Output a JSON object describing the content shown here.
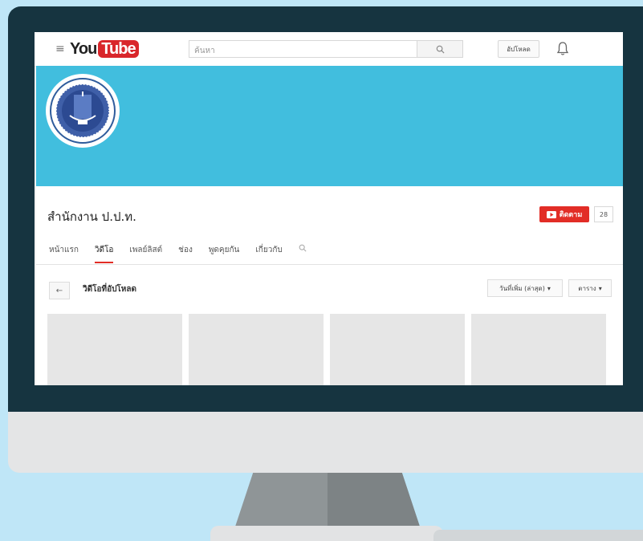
{
  "masthead": {
    "logo_you": "You",
    "logo_tube": "Tube",
    "search_placeholder": "ค้นหา",
    "upload_label": "อัปโหลด",
    "icons": [
      "menu-icon",
      "search-icon",
      "bell-icon"
    ]
  },
  "channel": {
    "name": "สำนักงาน ป.ป.ท.",
    "subscribe_label": "ติดตาม",
    "subscriber_count": "28"
  },
  "tabs": [
    {
      "label": "หน้าแรก",
      "active": false
    },
    {
      "label": "วิดีโอ",
      "active": true
    },
    {
      "label": "เพลย์ลิสต์",
      "active": false
    },
    {
      "label": "ช่อง",
      "active": false
    },
    {
      "label": "พูดคุยกัน",
      "active": false
    },
    {
      "label": "เกี่ยวกับ",
      "active": false
    }
  ],
  "content": {
    "back_label": "←",
    "section_title": "วิดีโอที่อัปโหลด",
    "sort_label": "วันที่เพิ่ม (ล่าสุด)",
    "view_label": "ตาราง"
  },
  "colors": {
    "banner": "#41bede",
    "brand_red": "#e22d26",
    "bezel": "#163440",
    "background": "#bfe6f7"
  }
}
